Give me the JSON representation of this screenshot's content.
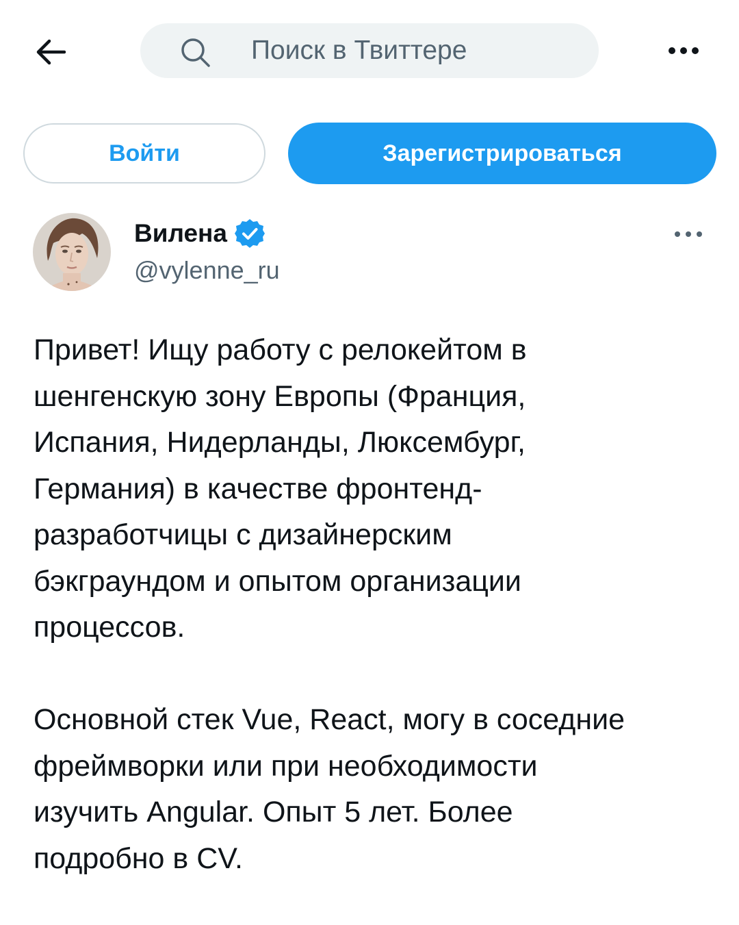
{
  "header": {
    "back_icon": "arrow-left-icon",
    "search": {
      "icon": "search-icon",
      "placeholder": "Поиск в Твиттере"
    },
    "more_icon": "more-horizontal-icon"
  },
  "auth": {
    "login_label": "Войти",
    "signup_label": "Зарегистрироваться"
  },
  "tweet": {
    "author": {
      "display_name": "Вилена",
      "handle": "@vylenne_ru",
      "verified_icon": "verified-badge-icon",
      "avatar_icon": "avatar-photo"
    },
    "more_icon": "more-horizontal-icon",
    "text": "Привет! Ищу работу с релокейтом в\nшенгенскую зону Европы (Франция,\nИспания, Нидерланды, Люксембург,\nГермания) в качестве фронтенд-\nразработчицы с дизайнерским\nбэкграундом и опытом организации\nпроцессов.\n\nОсновной стек Vue, React, могу в соседние\nфреймворки или при необходимости\nизучить Angular. Опыт 5 лет. Более\nподробно в CV."
  },
  "colors": {
    "accent": "#1d9bf0",
    "text_primary": "#0f1419",
    "text_secondary": "#536471",
    "search_bg": "#eff3f4",
    "border": "#cfd9de"
  }
}
